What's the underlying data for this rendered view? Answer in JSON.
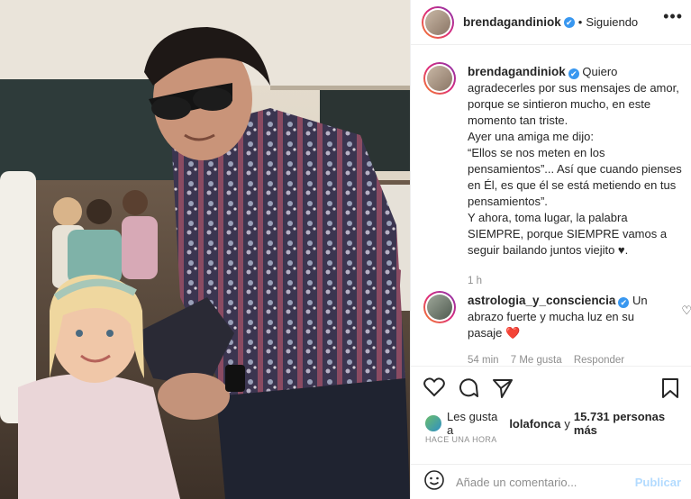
{
  "header": {
    "username": "brendagandiniok",
    "verified_mark": "✔",
    "separator": "•",
    "follow_status": "Siguiendo",
    "more_icon": "•••"
  },
  "caption": {
    "username": "brendagandiniok",
    "verified_mark": "✔",
    "lines": [
      "Quiero agradecerles por sus mensajes de amor, porque se sintieron mucho, en este momento tan triste.",
      "Ayer una amiga me dijo:",
      "“Ellos se nos meten en los pensamientos”... Así que cuando pienses en Él, es que él se está metiendo en tus pensamientos”.",
      "Y ahora, toma lugar, la palabra SIEMPRE, porque SIEMPRE vamos a seguir bailando juntos viejito ♥."
    ],
    "time": "1 h"
  },
  "comment": {
    "username": "astrologia_y_consciencia",
    "verified_mark": "✔",
    "text": "Un abrazo fuerte y mucha luz en su pasaje",
    "emoji": "❤️",
    "time": "54 min",
    "likes": "7 Me gusta",
    "reply": "Responder",
    "like_icon": "♡"
  },
  "actions": {
    "like_icon": "heart-icon",
    "comment_icon": "comment-icon",
    "share_icon": "share-icon",
    "save_icon": "bookmark-icon"
  },
  "likes": {
    "prefix": "Les gusta a",
    "user": "lolafonca",
    "middle": "y",
    "count": "15.731 personas más"
  },
  "timestamp": "HACE UNA HORA",
  "add_comment": {
    "placeholder": "Añade un comentario...",
    "publish_label": "Publicar"
  },
  "colors": {
    "verified": "#3897f0",
    "publish": "#b3dbff",
    "secondary_text": "#8e8e8e"
  }
}
